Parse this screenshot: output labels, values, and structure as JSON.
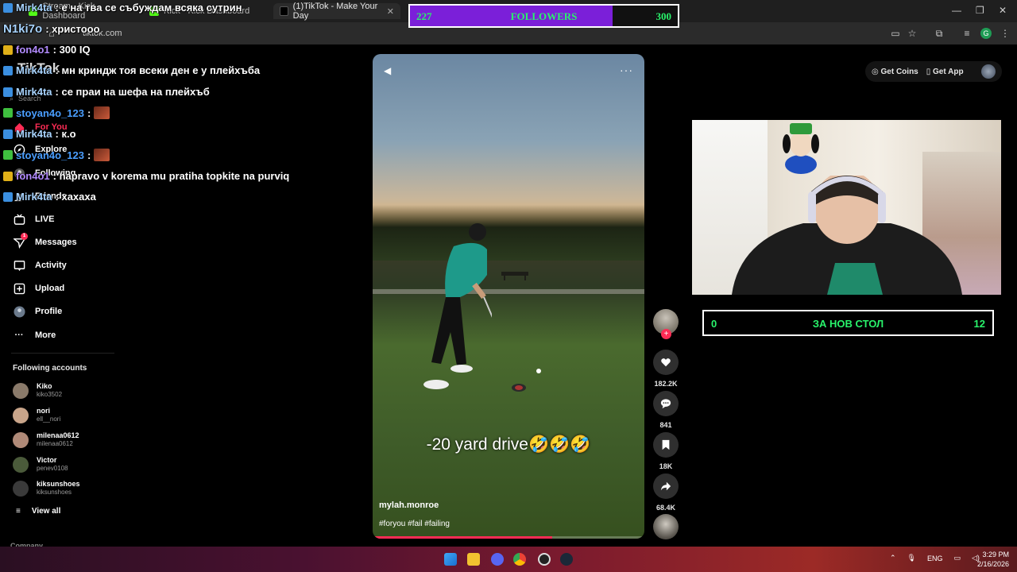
{
  "browser": {
    "tabs": [
      {
        "label": "Stream - Kick Dashboard",
        "active": false
      },
      {
        "label": "Kick - Kick Dashboard",
        "active": false
      },
      {
        "label": "(1)TikTok - Make Your Day",
        "active": true
      }
    ],
    "url": "tiktok.com"
  },
  "followers_goal": {
    "current": "227",
    "label": "FOLLOWERS",
    "target": "300",
    "fill_fraction": 0.757
  },
  "chat": [
    {
      "user": "Mirk4ta",
      "message": ": е на тва се събуждам всяка сутрин",
      "badge": "blue"
    },
    {
      "user": "N1ki7o",
      "message": ": христооо",
      "badge": "none"
    },
    {
      "user": "fon4o1",
      "message": ": 300 IQ",
      "badge": "gold"
    },
    {
      "user": "Mirk4ta",
      "message": ": мн криндж тоя всеки ден е у плейхъба",
      "badge": "blue"
    },
    {
      "user": "Mirk4ta",
      "message": ": се праи на шефа на плейхъб",
      "badge": "blue"
    },
    {
      "user": "stoyan4o_123",
      "message": ":",
      "badge": "green",
      "emote": true
    },
    {
      "user": "Mirk4ta",
      "message": ": к.о",
      "badge": "blue"
    },
    {
      "user": "stoyan4o_123",
      "message": ":",
      "badge": "green",
      "emote": true
    },
    {
      "user": "fon4o1",
      "message": ": napravo v korema mu pratiha topkite na purviq",
      "badge": "gold"
    },
    {
      "user": "Mirk4ta",
      "message": ": хахаха",
      "badge": "blue"
    }
  ],
  "sidebar": {
    "logo": "TikTok",
    "search_placeholder": "Search",
    "nav": [
      {
        "label": "For You",
        "icon": "home-icon"
      },
      {
        "label": "Explore",
        "icon": "compass-icon"
      },
      {
        "label": "Following",
        "icon": "following-icon"
      },
      {
        "label": "Friends",
        "icon": "friends-icon"
      },
      {
        "label": "LIVE",
        "icon": "live-icon"
      },
      {
        "label": "Messages",
        "icon": "messages-icon",
        "badge": "1"
      },
      {
        "label": "Activity",
        "icon": "activity-icon"
      },
      {
        "label": "Upload",
        "icon": "upload-icon"
      },
      {
        "label": "Profile",
        "icon": "profile-icon"
      },
      {
        "label": "More",
        "icon": "more-icon"
      }
    ],
    "following_title": "Following accounts",
    "accounts": [
      {
        "name": "Kiko",
        "username": "kiko3502",
        "color": "#8a7a6a"
      },
      {
        "name": "nori",
        "username": "ell__nori",
        "color": "#c9a58a"
      },
      {
        "name": "milenaa0612",
        "username": "milenaa0612",
        "color": "#b08a78"
      },
      {
        "name": "Victor",
        "username": "penev0108",
        "color": "#4a5a3a"
      },
      {
        "name": "kiksunshoes",
        "username": "kiksunshoes",
        "color": "#3a3a3a"
      }
    ],
    "view_all": "View all",
    "company": "Company"
  },
  "video": {
    "caption": "-20 yard drive🤣🤣🤣",
    "author": "mylah.monroe",
    "tags": "#foryou #fail #failing",
    "progress_fraction": 0.66
  },
  "actions": {
    "likes": "182.2K",
    "comments": "841",
    "saves": "18K",
    "shares": "68.4K"
  },
  "topright": {
    "get_coins": "Get Coins",
    "get_app": "Get App"
  },
  "goal": {
    "current": "0",
    "label": "ЗА НОВ СТОЛ",
    "target": "12"
  },
  "taskbar": {
    "lang": "ENG",
    "time": "3:29 PM",
    "date": "2/16/2026"
  },
  "colors": {
    "accent_pink": "#fe2c55",
    "goal_green": "#29f36b",
    "followers_purple": "#7b1fd9"
  }
}
